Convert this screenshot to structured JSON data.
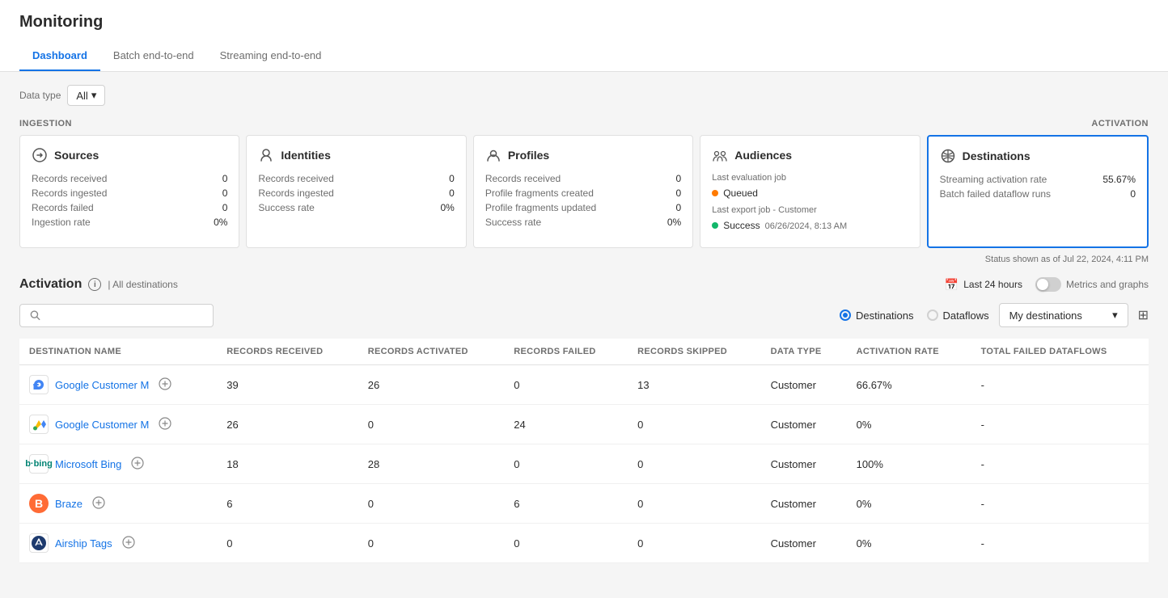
{
  "page": {
    "title": "Monitoring"
  },
  "tabs": [
    {
      "id": "dashboard",
      "label": "Dashboard",
      "active": true
    },
    {
      "id": "batch",
      "label": "Batch end-to-end",
      "active": false
    },
    {
      "id": "streaming",
      "label": "Streaming end-to-end",
      "active": false
    }
  ],
  "datatype": {
    "label": "Data type",
    "value": "All"
  },
  "sections": {
    "ingestion": "INGESTION",
    "activation": "ACTIVATION"
  },
  "cards": {
    "sources": {
      "title": "Sources",
      "rows": [
        {
          "label": "Records received",
          "value": "0"
        },
        {
          "label": "Records ingested",
          "value": "0"
        },
        {
          "label": "Records failed",
          "value": "0"
        },
        {
          "label": "Ingestion rate",
          "value": "0%"
        }
      ]
    },
    "identities": {
      "title": "Identities",
      "rows": [
        {
          "label": "Records received",
          "value": "0"
        },
        {
          "label": "Records ingested",
          "value": "0"
        },
        {
          "label": "Success rate",
          "value": "0%"
        }
      ]
    },
    "profiles": {
      "title": "Profiles",
      "rows": [
        {
          "label": "Records received",
          "value": "0"
        },
        {
          "label": "Profile fragments created",
          "value": "0"
        },
        {
          "label": "Profile fragments updated",
          "value": "0"
        },
        {
          "label": "Success rate",
          "value": "0%"
        }
      ]
    },
    "audiences": {
      "title": "Audiences",
      "lastEvalJob": "Last evaluation job",
      "queued": "Queued",
      "lastExportJob": "Last export job - Customer",
      "success": "Success",
      "successDate": "06/26/2024, 8:13 AM"
    },
    "destinations": {
      "title": "Destinations",
      "rows": [
        {
          "label": "Streaming activation rate",
          "value": "55.67%"
        },
        {
          "label": "Batch failed dataflow runs",
          "value": "0"
        }
      ]
    }
  },
  "status": {
    "text": "Status shown as of Jul 22, 2024, 4:11 PM"
  },
  "activation": {
    "title": "Activation",
    "allDestinations": "| All destinations",
    "timeFilter": "Last 24 hours",
    "metricsLabel": "Metrics and graphs"
  },
  "table": {
    "searchPlaceholder": "",
    "radioOptions": [
      {
        "label": "Destinations",
        "active": true
      },
      {
        "label": "Dataflows",
        "active": false
      }
    ],
    "destinationFilter": "My destinations",
    "columns": [
      "DESTINATION NAME",
      "RECORDS RECEIVED",
      "RECORDS ACTIVATED",
      "RECORDS FAILED",
      "RECORDS SKIPPED",
      "DATA TYPE",
      "ACTIVATION RATE",
      "TOTAL FAILED DATAFLOWS"
    ],
    "rows": [
      {
        "name": "Google Customer M",
        "logo": "▶",
        "logoType": "google-display",
        "recordsReceived": "39",
        "recordsActivated": "26",
        "recordsFailed": "0",
        "recordsSkipped": "13",
        "dataType": "Customer",
        "activationRate": "66.67%",
        "totalFailed": "-"
      },
      {
        "name": "Google Customer M",
        "logo": "▲",
        "logoType": "google-ads",
        "recordsReceived": "26",
        "recordsActivated": "0",
        "recordsFailed": "24",
        "recordsSkipped": "0",
        "dataType": "Customer",
        "activationRate": "0%",
        "totalFailed": "-"
      },
      {
        "name": "Microsoft Bing",
        "logo": "b·bing",
        "logoType": "bing",
        "recordsReceived": "18",
        "recordsActivated": "28",
        "recordsFailed": "0",
        "recordsSkipped": "0",
        "dataType": "Customer",
        "activationRate": "100%",
        "totalFailed": "-"
      },
      {
        "name": "Braze",
        "logo": "B",
        "logoType": "braze",
        "recordsReceived": "6",
        "recordsActivated": "0",
        "recordsFailed": "6",
        "recordsSkipped": "0",
        "dataType": "Customer",
        "activationRate": "0%",
        "totalFailed": "-"
      },
      {
        "name": "Airship Tags",
        "logo": "✈",
        "logoType": "airship",
        "recordsReceived": "0",
        "recordsActivated": "0",
        "recordsFailed": "0",
        "recordsSkipped": "0",
        "dataType": "Customer",
        "activationRate": "0%",
        "totalFailed": "-"
      }
    ]
  }
}
